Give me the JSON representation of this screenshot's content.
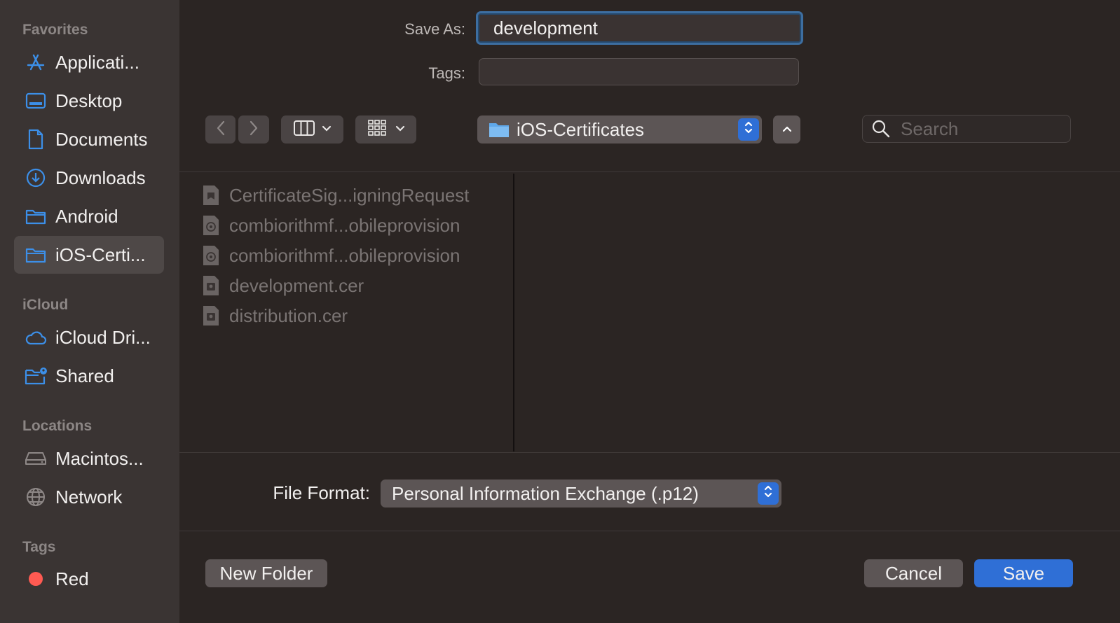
{
  "sidebar": {
    "sections": [
      {
        "title": "Favorites",
        "items": [
          {
            "label": "Applicati...",
            "icon": "app-store-icon"
          },
          {
            "label": "Desktop",
            "icon": "desktop-icon"
          },
          {
            "label": "Documents",
            "icon": "document-icon"
          },
          {
            "label": "Downloads",
            "icon": "download-icon"
          },
          {
            "label": "Android",
            "icon": "folder-icon"
          },
          {
            "label": "iOS-Certi...",
            "icon": "folder-icon",
            "selected": true
          }
        ]
      },
      {
        "title": "iCloud",
        "items": [
          {
            "label": "iCloud Dri...",
            "icon": "cloud-icon"
          },
          {
            "label": "Shared",
            "icon": "shared-folder-icon"
          }
        ]
      },
      {
        "title": "Locations",
        "items": [
          {
            "label": "Macintos...",
            "icon": "drive-icon"
          },
          {
            "label": "Network",
            "icon": "globe-icon"
          }
        ]
      },
      {
        "title": "Tags",
        "items": [
          {
            "label": "Red",
            "icon": "red-tag-icon",
            "tag_color": "#ff5a52"
          }
        ]
      }
    ]
  },
  "save_as": {
    "label": "Save As:",
    "value": "development"
  },
  "tags": {
    "label": "Tags:",
    "value": ""
  },
  "toolbar": {
    "location": "iOS-Certificates",
    "search_placeholder": "Search"
  },
  "files": [
    {
      "name": "CertificateSig...igningRequest",
      "icon": "certificate-request-icon"
    },
    {
      "name": "combiorithmf...obileprovision",
      "icon": "provisioning-profile-icon"
    },
    {
      "name": "combiorithmf...obileprovision",
      "icon": "provisioning-profile-icon"
    },
    {
      "name": "development.cer",
      "icon": "certificate-file-icon"
    },
    {
      "name": "distribution.cer",
      "icon": "certificate-file-icon"
    }
  ],
  "file_format": {
    "label": "File Format:",
    "value": "Personal Information Exchange (.p12)"
  },
  "buttons": {
    "new_folder": "New Folder",
    "cancel": "Cancel",
    "save": "Save"
  },
  "colors": {
    "accent": "#2f6fd6",
    "sidebar_icon": "#3c8fe8"
  }
}
